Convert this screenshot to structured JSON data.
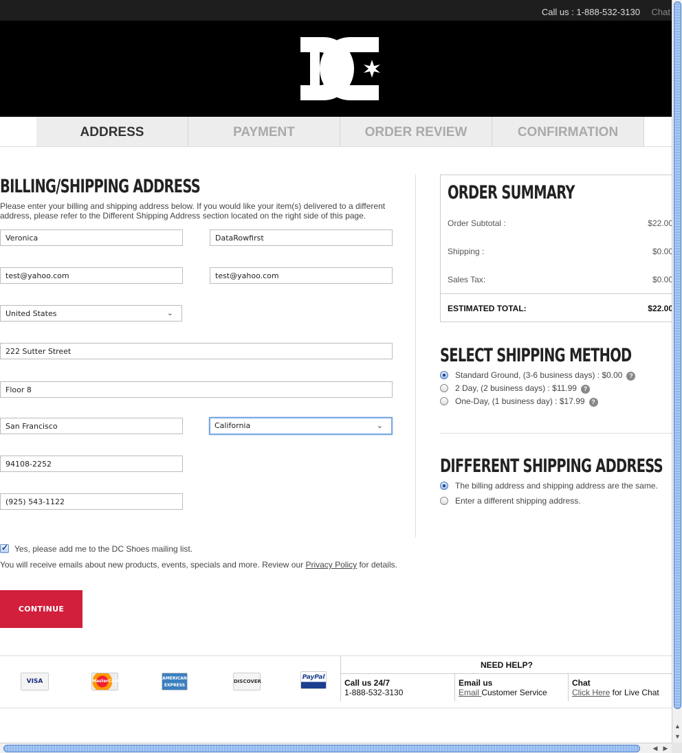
{
  "topbar": {
    "call": "Call us : 1-888-532-3130",
    "chat": "Chat"
  },
  "header": {
    "logo_icon": "dc-shoes-logo"
  },
  "steps": [
    "ADDRESS",
    "PAYMENT",
    "ORDER REVIEW",
    "CONFIRMATION"
  ],
  "billing": {
    "title": "BILLING/SHIPPING ADDRESS",
    "intro": "Please enter your billing and shipping address below. If you would like your item(s) delivered to a different address, please refer to the Different Shipping Address section located on the right side of this page.",
    "first_name": "Veronica",
    "last_name": "DataRowfirst",
    "email": "test@yahoo.com",
    "email_confirm": "test@yahoo.com",
    "country": "United States",
    "address1": "222 Sutter Street",
    "address2": "Floor 8",
    "city": "San Francisco",
    "state": "California",
    "zip": "94108-2252",
    "phone": "(925) 543-1122"
  },
  "mailing": {
    "label": "Yes, please add me to the DC Shoes mailing list.",
    "note_pre": "You will receive emails about new products, events, specials and more. Review our ",
    "privacy_link": "Privacy Policy",
    "note_post": " for details."
  },
  "continue_label": "CONTINUE",
  "summary": {
    "title": "ORDER SUMMARY",
    "subtotal_label": "Order Subtotal :",
    "subtotal": "$22.00",
    "shipping_label": "Shipping :",
    "shipping": "$0.00",
    "tax_label": "Sales Tax:",
    "tax": "$0.00",
    "total_label": "ESTIMATED TOTAL:",
    "total": "$22.00"
  },
  "shipping_method": {
    "title": "SELECT SHIPPING METHOD",
    "options": [
      "Standard Ground, (3-6 business days) : $0.00",
      "2 Day, (2 business days) : $11.99",
      "One-Day, (1 business day) : $17.99"
    ],
    "help_glyph": "?"
  },
  "different_address": {
    "title": "DIFFERENT SHIPPING ADDRESS",
    "options": [
      "The billing address and shipping address are the same.",
      "Enter a different shipping address."
    ]
  },
  "footer": {
    "cards": [
      "VISA",
      "MasterCard",
      "AMERICAN EXPRESS",
      "DISCOVER",
      "PayPal"
    ],
    "help_title": "NEED HELP?",
    "call_title": "Call us 24/7",
    "call_number": "1-888-532-3130",
    "email_title": "Email us",
    "email_link": "Email ",
    "email_text": "Customer Service",
    "chat_title": "Chat",
    "chat_link": "Click Here",
    "chat_text": " for Live Chat"
  },
  "colors": {
    "continue": "#d21f3c",
    "header_bg": "#000000",
    "topbar_bg": "#1e1e1e"
  }
}
